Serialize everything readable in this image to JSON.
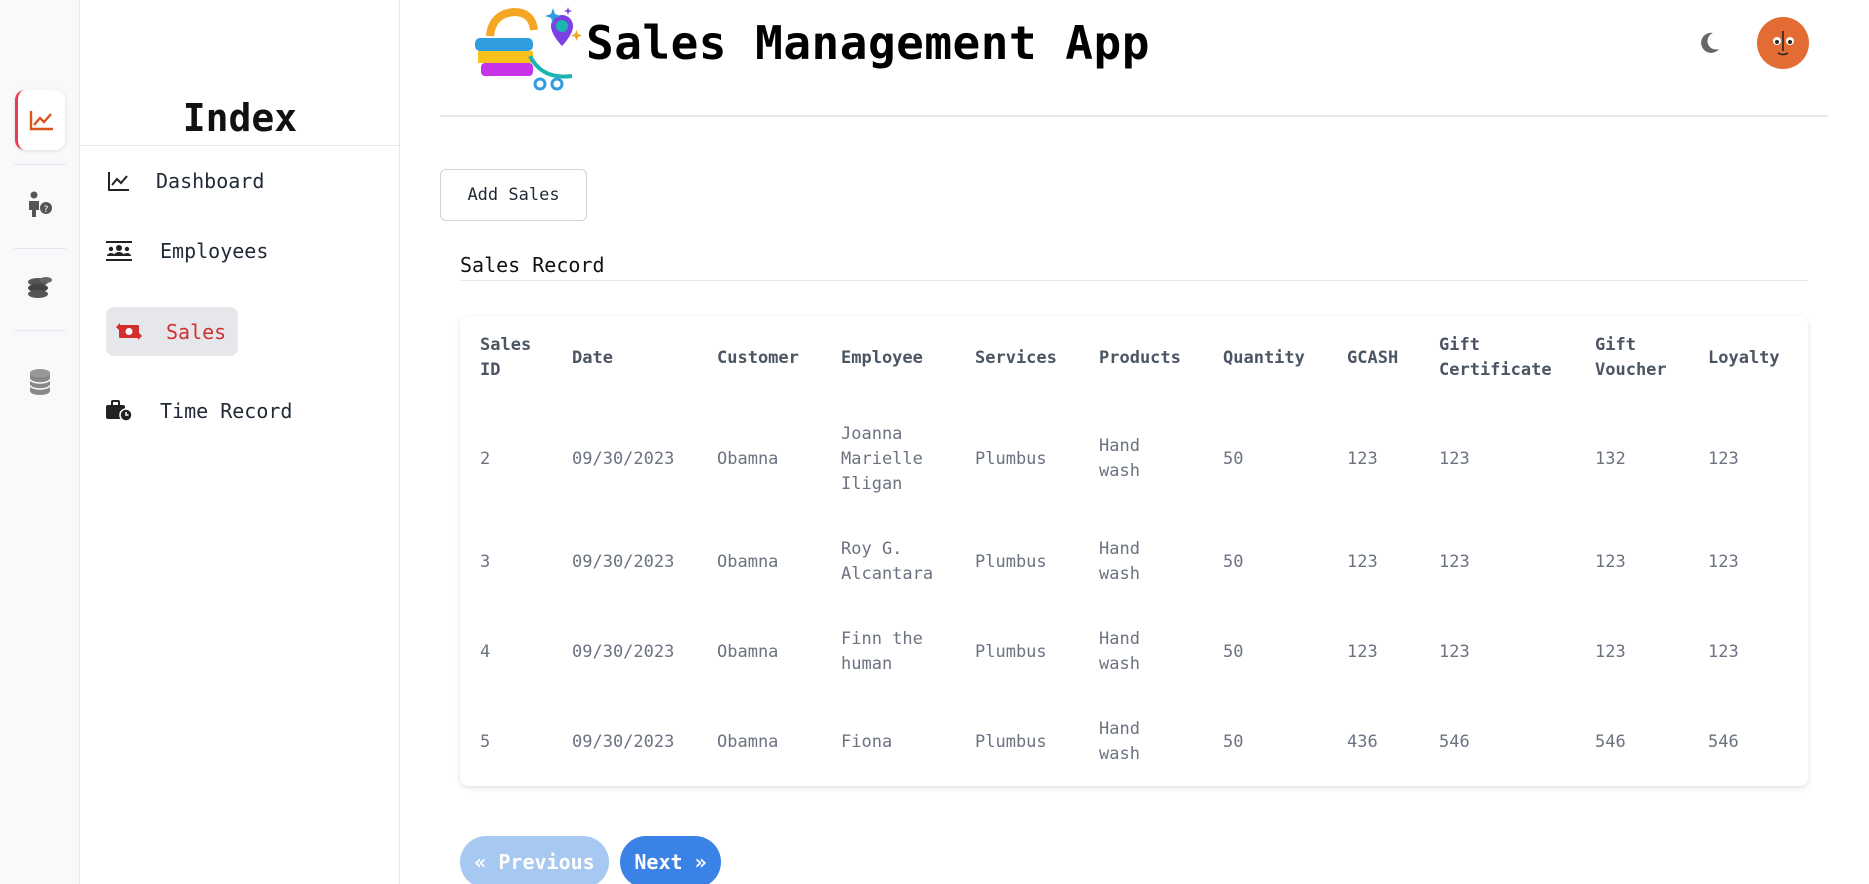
{
  "app": {
    "title": "Sales Management App"
  },
  "sidebar": {
    "title": "Index",
    "items": [
      {
        "label": "Dashboard",
        "icon": "chart-line-icon"
      },
      {
        "label": "Employees",
        "icon": "users-icon"
      },
      {
        "label": "Sales",
        "icon": "money-exchange-icon",
        "active": true
      },
      {
        "label": "Time Record",
        "icon": "briefcase-clock-icon"
      }
    ]
  },
  "rail": {
    "icons": [
      "chart-line-icon",
      "person-help-icon",
      "coins-icon",
      "database-icon"
    ]
  },
  "header": {
    "theme_icon": "moon-icon",
    "avatar": "avatar"
  },
  "main": {
    "add_button": "Add Sales",
    "section_title": "Sales Record",
    "table": {
      "columns": [
        "Sales ID",
        "Date",
        "Customer",
        "Employee",
        "Services",
        "Products",
        "Quantity",
        "GCASH",
        "Gift Certificate",
        "Gift Voucher",
        "Loyalty"
      ],
      "rows": [
        [
          "2",
          "09/30/2023",
          "Obamna",
          "Joanna Marielle Iligan",
          "Plumbus",
          "Hand wash",
          "50",
          "123",
          "123",
          "132",
          "123"
        ],
        [
          "3",
          "09/30/2023",
          "Obamna",
          "Roy G. Alcantara",
          "Plumbus",
          "Hand wash",
          "50",
          "123",
          "123",
          "123",
          "123"
        ],
        [
          "4",
          "09/30/2023",
          "Obamna",
          "Finn the human",
          "Plumbus",
          "Hand wash",
          "50",
          "123",
          "123",
          "123",
          "123"
        ],
        [
          "5",
          "09/30/2023",
          "Obamna",
          "Fiona",
          "Plumbus",
          "Hand wash",
          "50",
          "436",
          "546",
          "546",
          "546"
        ]
      ]
    },
    "pagination": {
      "previous": "« Previous",
      "next": "Next »"
    }
  },
  "colors": {
    "accent": "#d32f2f",
    "primary": "#3b82e6",
    "primary_light": "#a7c8f0",
    "avatar": "#e36b34"
  }
}
